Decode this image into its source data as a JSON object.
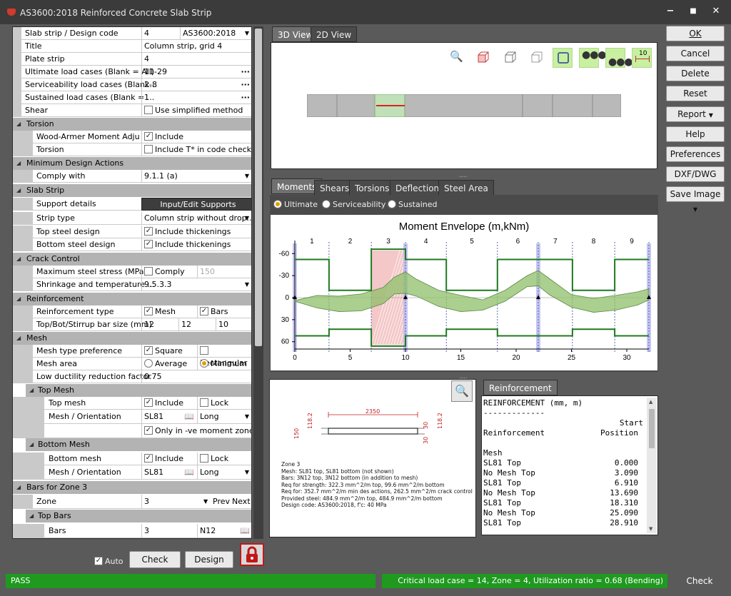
{
  "window": {
    "title": "AS3600:2018 Reinforced Concrete Slab Strip",
    "minimize": "−",
    "maximize": "■",
    "close": "✕"
  },
  "grid": {
    "slab_strip": {
      "label": "Slab strip / Design code",
      "value": "4",
      "code": "AS3600:2018"
    },
    "title": {
      "label": "Title",
      "value": "Column strip, grid 4"
    },
    "plate_strip": {
      "label": "Plate strip",
      "value": "4"
    },
    "ult": {
      "label": "Ultimate load cases (Blank = All)",
      "value": "11-29"
    },
    "svc": {
      "label": "Serviceability load cases (Blank...",
      "value": "2-8"
    },
    "sus": {
      "label": "Sustained load cases (Blank = ...",
      "value": "1"
    },
    "shear": {
      "label": "Shear",
      "value": "Use simplified method"
    },
    "torsion_sec": "Torsion",
    "wood": {
      "label": "Wood-Armer Moment Adjus...",
      "value": "Include"
    },
    "torsion": {
      "label": "Torsion",
      "value": "Include T* in code checks"
    },
    "mda_sec": "Minimum Design Actions",
    "comply": {
      "label": "Comply with",
      "value": "9.1.1 (a)"
    },
    "slab_sec": "Slab Strip",
    "support": {
      "label": "Support details",
      "value": "Input/Edit Supports"
    },
    "strip_type": {
      "label": "Strip type",
      "value": "Column strip without drop..."
    },
    "top_steel": {
      "label": "Top steel design",
      "value": "Include thickenings"
    },
    "bot_steel": {
      "label": "Bottom steel design",
      "value": "Include thickenings"
    },
    "crack_sec": "Crack Control",
    "max_stress": {
      "label": "Maximum steel stress (MPa)",
      "value": "Comply",
      "extra": "150"
    },
    "shrink": {
      "label": "Shrinkage and temperature ...",
      "value": "9.5.3.3"
    },
    "reinf_sec": "Reinforcement",
    "reinf_type": {
      "label": "Reinforcement type",
      "a": "Mesh",
      "b": "Bars"
    },
    "bar_size": {
      "label": "Top/Bot/Stirrup bar size (mm)",
      "a": "12",
      "b": "12",
      "c": "10"
    },
    "mesh_sec": "Mesh",
    "mesh_pref": {
      "label": "Mesh type preference",
      "a": "Square",
      "b": "Rectangular"
    },
    "mesh_area": {
      "label": "Mesh area",
      "a": "Average",
      "b": "Minimum"
    },
    "low_duct": {
      "label": "Low ductility reduction factor",
      "value": "0.75"
    },
    "top_mesh_sec": "Top Mesh",
    "top_mesh": {
      "label": "Top mesh",
      "a": "Include",
      "b": "Lock"
    },
    "top_orient": {
      "label": "Mesh / Orientation",
      "a": "SL81",
      "b": "Long"
    },
    "neg_only": {
      "value": "Only in -ve moment zones"
    },
    "bot_mesh_sec": "Bottom Mesh",
    "bot_mesh": {
      "label": "Bottom mesh",
      "a": "Include",
      "b": "Lock"
    },
    "bot_orient": {
      "label": "Mesh / Orientation",
      "a": "SL81",
      "b": "Long"
    },
    "bars_sec": "Bars for Zone 3",
    "zone": {
      "label": "Zone",
      "value": "3",
      "prev": "Prev",
      "next": "Next"
    },
    "top_bars_sec": "Top Bars",
    "bars": {
      "label": "Bars",
      "a": "3",
      "b": "N12"
    }
  },
  "bottom_left": {
    "auto": "Auto",
    "check": "Check",
    "design": "Design"
  },
  "buttons": {
    "ok": "OK",
    "cancel": "Cancel",
    "delete": "Delete",
    "reset": "Reset",
    "report": "Report",
    "help": "Help",
    "preferences": "Preferences",
    "dxf": "DXF/DWG",
    "save_image": "Save Image"
  },
  "view_tabs": [
    "3D View",
    "2D View"
  ],
  "toolbar_icons": [
    "zoom-icon",
    "box-front-icon",
    "box-wire-icon",
    "box-outline-icon",
    "slab-outline-icon",
    "dots-top-icon",
    "dots-bottom-icon",
    "dimension-icon"
  ],
  "toolbar_dim": "10",
  "result_tabs": [
    "Moments",
    "Shears",
    "Torsions",
    "Deflections",
    "Steel Area"
  ],
  "load_options": [
    "Ultimate",
    "Serviceability",
    "Sustained"
  ],
  "chart_data": {
    "type": "line",
    "title": "Moment Envelope (m,kNm)",
    "xlim": [
      0,
      32
    ],
    "ylim": [
      -70,
      70
    ],
    "x_ticks": [
      0,
      5,
      10,
      15,
      20,
      25,
      30
    ],
    "y_ticks": [
      -60,
      -30,
      0,
      30,
      60
    ],
    "zone_labels": [
      "1",
      "2",
      "3",
      "4",
      "5",
      "6",
      "7",
      "8",
      "9"
    ],
    "zone_bounds": [
      0,
      3.09,
      6.91,
      10,
      13.69,
      18.31,
      22,
      25.09,
      28.91,
      32
    ],
    "supports": [
      0,
      10,
      22,
      32
    ],
    "highlight_zone": [
      6.91,
      10
    ],
    "capacity_top": [
      -52,
      -10,
      -66,
      -52,
      -10,
      -52,
      -52,
      -10,
      -52
    ],
    "capacity_bottom": [
      52,
      43,
      66,
      52,
      43,
      52,
      52,
      43,
      52
    ],
    "envelope_x": [
      0,
      2,
      4,
      6,
      8,
      9,
      10,
      11,
      13,
      15,
      17,
      19,
      21,
      22,
      23,
      25,
      27,
      29,
      31,
      32
    ],
    "envelope_min": [
      4,
      -3,
      -2,
      -5,
      -14,
      -28,
      -35,
      -25,
      -10,
      -3,
      3,
      -10,
      -30,
      -37,
      -26,
      -4,
      1,
      -3,
      -8,
      -12
    ],
    "envelope_max": [
      5,
      14,
      19,
      18,
      8,
      -5,
      -6,
      -2,
      12,
      19,
      17,
      5,
      -15,
      -16,
      -4,
      13,
      20,
      17,
      10,
      3
    ]
  },
  "section": {
    "zone_label": "Zone 3",
    "dims": {
      "len": "2350",
      "d150": "150",
      "d1182": "118.2",
      "d30a": "30",
      "d30b": "30",
      "d1182b": "118.2"
    },
    "notes": [
      "Mesh: SL81 top, SL81 bottom (not shown)",
      "Bars: 3N12 top, 3N12 bottom  (in addition to mesh)",
      "Req for strength: 322.3 mm^2/m top, 99.6 mm^2/m bottom",
      "Req for: 352.7 mm^2/m min des actions, 262.5 mm^2/m crack control",
      "Provided steel: 484.9 mm^2/m top, 484.9 mm^2/m bottom",
      "Design code: AS3600:2018, f'c: 40 MPa"
    ]
  },
  "reinforcement": {
    "tab": "Reinforcement",
    "header": "REINFORCEMENT (mm, m)",
    "rule": "-------------",
    "col1": "Reinforcement",
    "col2a": "Start",
    "col2b": "Position",
    "group": "Mesh",
    "rows": [
      [
        "SL81 Top",
        "0.000"
      ],
      [
        "No Mesh Top",
        "3.090"
      ],
      [
        "SL81 Top",
        "6.910"
      ],
      [
        "No Mesh Top",
        "13.690"
      ],
      [
        "SL81 Top",
        "18.310"
      ],
      [
        "No Mesh Top",
        "25.090"
      ],
      [
        "SL81 Top",
        "28.910"
      ]
    ]
  },
  "status": {
    "left": "PASS",
    "right": "Critical load case = 14, Zone = 4, Utilization ratio = 0.68 (Bending)",
    "check": "Check"
  },
  "colors": {
    "pass": "#1f9a1f",
    "envelope": "#8fbf6a",
    "capacity": "#1f7a1f",
    "highlight": "#f0b0b0"
  }
}
